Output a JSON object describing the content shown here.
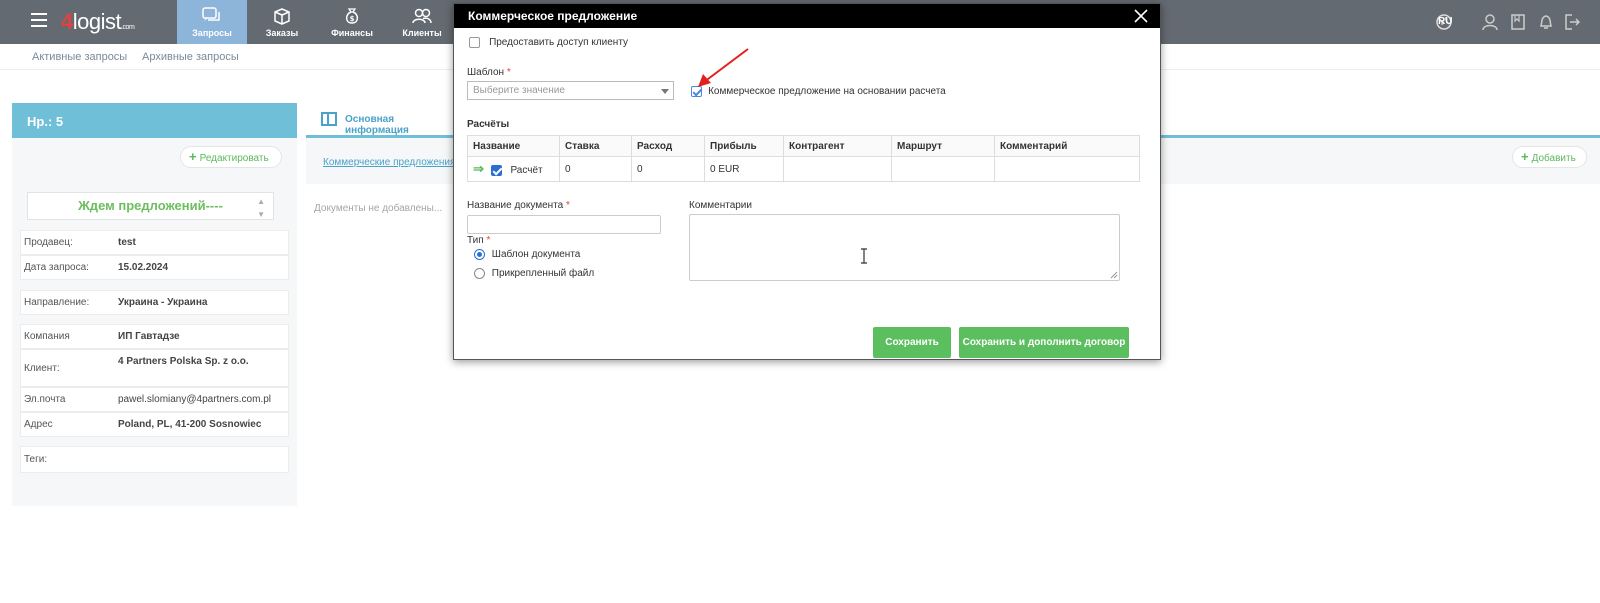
{
  "header": {
    "logo_num": "4",
    "logo_text": "logist",
    "logo_suffix": ".com",
    "nav": [
      {
        "label": "Запросы",
        "icon": "chat-icon",
        "active": true
      },
      {
        "label": "Заказы",
        "icon": "box-icon"
      },
      {
        "label": "Финансы",
        "icon": "money-bag-icon"
      },
      {
        "label": "Клиенты",
        "icon": "users-icon"
      }
    ],
    "lang": "RU"
  },
  "subnav": {
    "active": "Активные запросы",
    "archive": "Архивные запросы"
  },
  "request": {
    "number": "Нр.: 5",
    "edit_label": "Редактировать",
    "status": "Ждем предложений----",
    "rows": [
      {
        "key": "Продавец:",
        "value": "test"
      },
      {
        "key": "Дата запроса:",
        "value": "15.02.2024"
      },
      {
        "key": "Направление:",
        "value": "Украина - Украина"
      },
      {
        "key": "Компания",
        "value": "ИП Гавтадзе"
      },
      {
        "key": "Клиент:",
        "value": "4 Partners Polska Sp. z o.o."
      },
      {
        "key": "Эл.почта",
        "value": "pawel.slomiany@4partners.com.pl"
      },
      {
        "key": "Адрес",
        "value": "Poland, PL, 41-200 Sosnowiec"
      },
      {
        "key": "Теги:",
        "value": ""
      }
    ]
  },
  "main": {
    "tab_label": "Основная информация",
    "link_label": "Коммерческие предложения",
    "add_label": "Добавить",
    "no_docs": "Документы не добавлены..."
  },
  "modal": {
    "title": "Коммерческое предложение",
    "client_access": "Предоставить доступ клиенту",
    "template_label": "Шаблон",
    "template_placeholder": "Выберите значение",
    "based_on_calc": "Коммерческое предложение на основании расчета",
    "calcs_label": "Расчёты",
    "table": {
      "headers": [
        "Название",
        "Ставка",
        "Расход",
        "Прибыль",
        "Контрагент",
        "Маршрут",
        "Комментарий"
      ],
      "row": [
        "Расчёт",
        "0",
        "0",
        "0 EUR",
        "",
        "",
        ""
      ]
    },
    "doc_name_label": "Название документа",
    "comments_label": "Комментарии",
    "type_label": "Тип",
    "type_options": [
      "Шаблон документа",
      "Прикрепленный файл"
    ],
    "save_label": "Сохранить",
    "save_contract_label": "Сохранить и дополнить договор"
  },
  "colors": {
    "topbar": "#646a71",
    "active_nav": "#8db4d9",
    "accent_blue": "#6fbfd9",
    "green": "#5bbf5f",
    "annotation_red": "#e2201c"
  }
}
